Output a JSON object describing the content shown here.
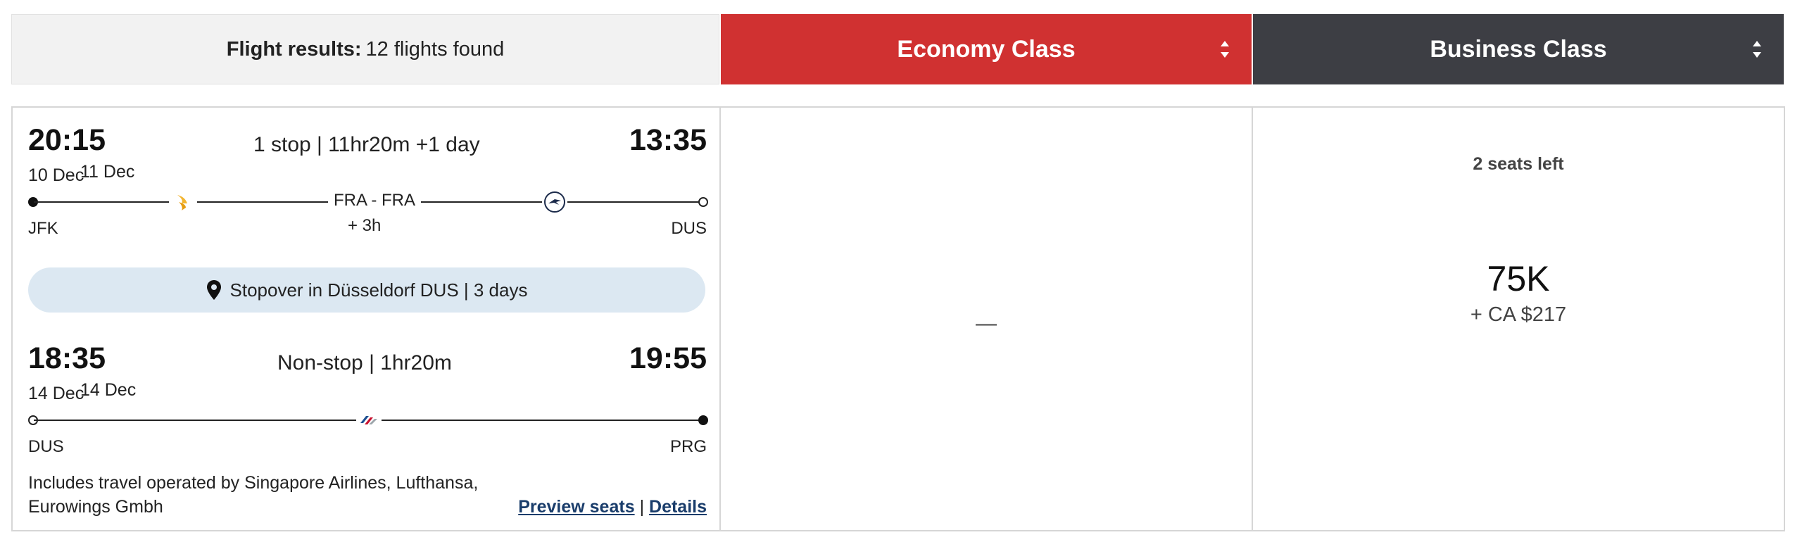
{
  "header": {
    "results_label": "Flight results:",
    "results_count": "12 flights found",
    "economy_label": "Economy Class",
    "business_label": "Business Class",
    "economy_color": "#d03131",
    "business_color": "#3d3e44"
  },
  "flight": {
    "leg1": {
      "depart_time": "20:15",
      "depart_date": "10 Dec",
      "arrive_date": "11 Dec",
      "summary": "1 stop | 11hr20m",
      "day_offset": "+1 day",
      "arrive_time": "13:35",
      "origin": "JFK",
      "stop_label": "FRA  - FRA",
      "layover": "+ 3h",
      "destination": "DUS",
      "carriers": [
        "singapore-airlines-icon",
        "lufthansa-icon"
      ]
    },
    "stopover": {
      "text": "Stopover in Düsseldorf DUS | 3 days",
      "icon": "map-pin-icon"
    },
    "leg2": {
      "depart_time": "18:35",
      "depart_date": "14 Dec",
      "arrive_date": "14 Dec",
      "summary": "Non-stop | 1hr20m",
      "arrive_time": "19:55",
      "origin": "DUS",
      "destination": "PRG",
      "carriers": [
        "american-airlines-icon"
      ]
    },
    "operated_by": "Includes travel operated by Singapore Airlines, Lufthansa, Eurowings Gmbh",
    "preview_seats": "Preview seats",
    "separator": "|",
    "details": "Details"
  },
  "economy": {
    "availability": "—"
  },
  "business": {
    "seats_left": "2 seats left",
    "miles": "75K",
    "cash": "+ CA $217"
  }
}
